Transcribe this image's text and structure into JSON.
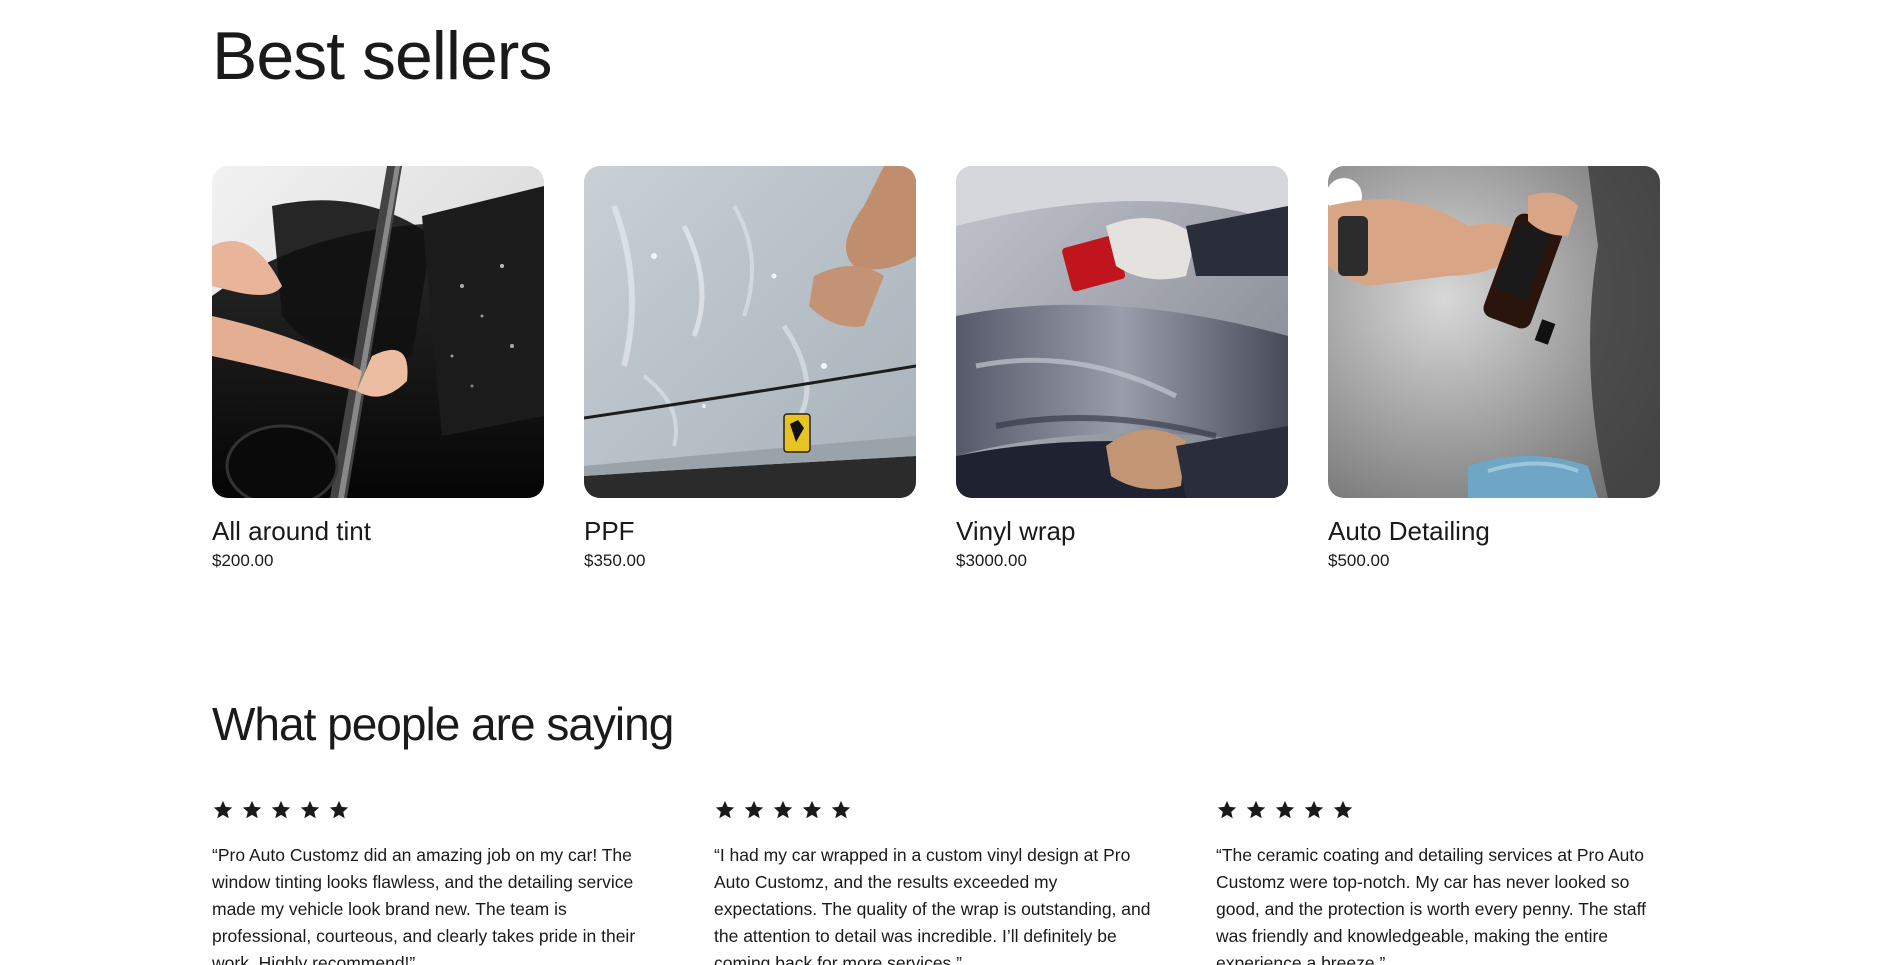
{
  "best_sellers": {
    "title": "Best sellers",
    "products": [
      {
        "name": "All around tint",
        "price": "$200.00",
        "image": "window-tint-photo"
      },
      {
        "name": "PPF",
        "price": "$350.00",
        "image": "paint-protection-film-photo"
      },
      {
        "name": "Vinyl wrap",
        "price": "$3000.00",
        "image": "vinyl-wrap-photo"
      },
      {
        "name": "Auto Detailing",
        "price": "$500.00",
        "image": "ceramic-coating-photo"
      }
    ]
  },
  "testimonials": {
    "title": "What people are saying",
    "reviews": [
      {
        "rating": 5,
        "text": "“Pro Auto Customz did an amazing job on my car! The window tinting looks flawless, and the detailing service made my vehicle look brand new. The team is professional, courteous, and clearly takes pride in their work. Highly recommend!”"
      },
      {
        "rating": 5,
        "text": "“I had my car wrapped in a custom vinyl design at Pro Auto Customz, and the results exceeded my expectations. The quality of the wrap is outstanding, and the attention to detail was incredible. I’ll definitely be coming back for more services.”"
      },
      {
        "rating": 5,
        "text": "“The ceramic coating and detailing services at Pro Auto Customz were top-notch. My car has never looked so good, and the protection is worth every penny. The staff was friendly and knowledgeable, making the entire experience a breeze.”"
      }
    ]
  },
  "icons": {
    "star": "star-icon"
  }
}
